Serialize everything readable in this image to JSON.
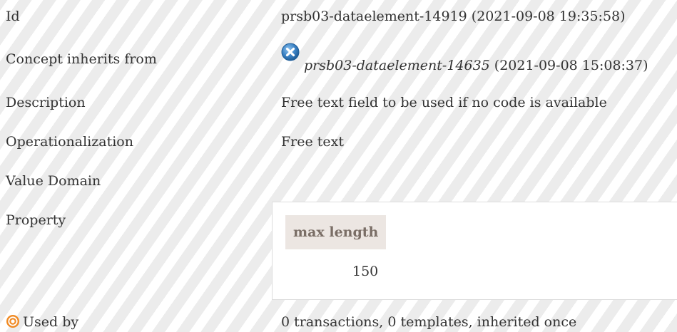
{
  "rows": {
    "id": {
      "label": "Id",
      "value": "prsb03-dataelement-14919 (2021-09-08 19:35:58)"
    },
    "inherits": {
      "label": "Concept inherits from",
      "concept_id": "prsb03-dataelement-14635",
      "concept_date": "(2021-09-08 15:08:37)",
      "icon": "inherit-status-icon"
    },
    "description": {
      "label": "Description",
      "value": "Free text field to be used if no code is available"
    },
    "operationalization": {
      "label": "Operationalization",
      "value": "Free text"
    },
    "value_domain": {
      "label": "Value Domain",
      "value": ""
    },
    "property": {
      "label": "Property",
      "header": "max length",
      "value": "150"
    },
    "used_by": {
      "label": "Used by",
      "icon": "target-icon",
      "value": "0 transactions, 0 templates, inherited once"
    }
  },
  "colors": {
    "icon_blue": "#3b82c4",
    "target_orange": "#f08a24",
    "header_bg": "#ece6e2",
    "header_text": "#7a6e66"
  }
}
